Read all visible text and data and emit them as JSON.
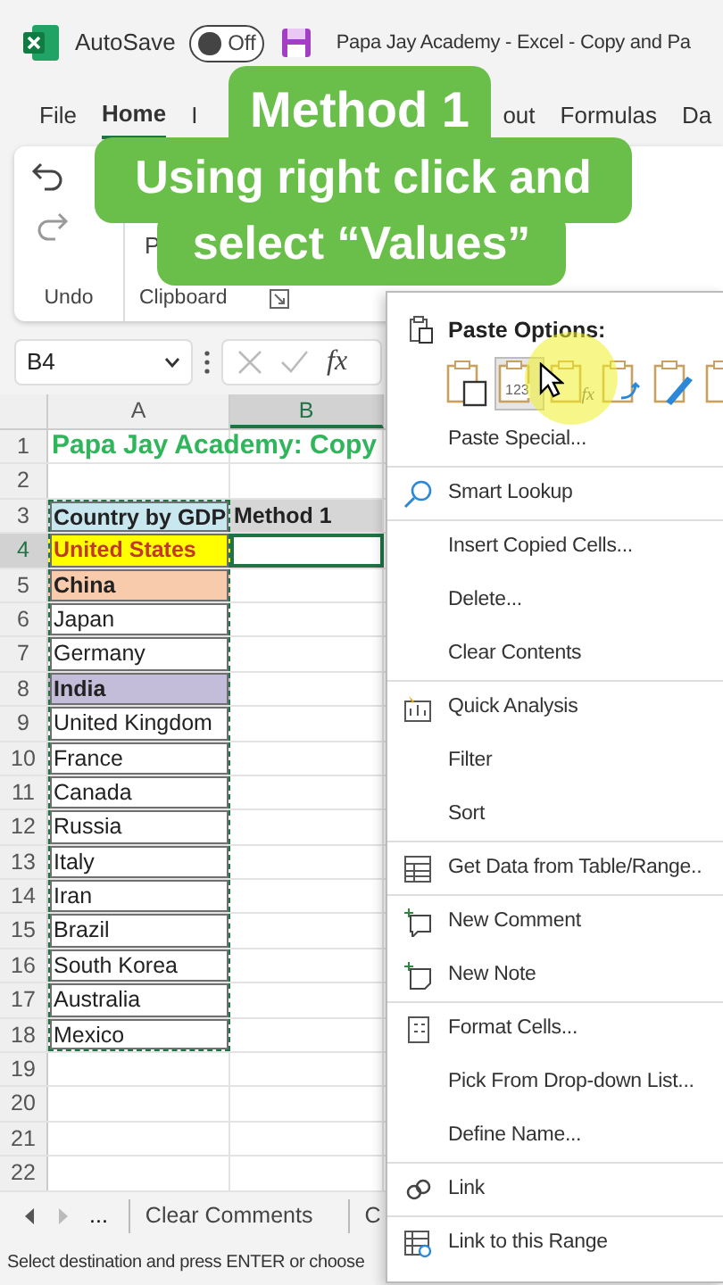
{
  "title_bar": {
    "autosave_label": "AutoSave",
    "autosave_on": false,
    "toggle_text": "Off",
    "title": "Papa Jay Academy - Excel - Copy and Pa"
  },
  "ribbon_tabs": [
    {
      "label": "File",
      "selected": false
    },
    {
      "label": "Home",
      "selected": true
    },
    {
      "label": "I",
      "selected": false
    },
    {
      "label": "out",
      "selected": false
    },
    {
      "label": "Formulas",
      "selected": false
    },
    {
      "label": "Da",
      "selected": false
    }
  ],
  "ribbon_groups": [
    {
      "label": "Undo"
    },
    {
      "label": "Clipboard",
      "partial_button": "P"
    }
  ],
  "caption": [
    "Method 1",
    "Using right click and",
    "select “Values”"
  ],
  "formula_bar": {
    "name_box": "B4",
    "fx": "fx"
  },
  "columns": [
    {
      "label": "A",
      "selected": false
    },
    {
      "label": "B",
      "selected": true
    }
  ],
  "rows": [
    {
      "number": "1",
      "selected": false,
      "copied": false,
      "table": false,
      "cells": [
        {
          "text": "Papa Jay Academy: Copy",
          "kind": "title"
        }
      ]
    },
    {
      "number": "2",
      "selected": false,
      "copied": false,
      "table": false,
      "cells": []
    },
    {
      "number": "3",
      "selected": false,
      "copied": true,
      "table": true,
      "cells": [
        {
          "text": "Country by GDP",
          "kind": "bold",
          "color": "#c9e7ef"
        },
        {
          "text": "Method 1",
          "kind": "bold",
          "color": "#d6d6d6"
        }
      ]
    },
    {
      "number": "4",
      "selected": true,
      "copied": true,
      "table": true,
      "cells": [
        {
          "text": "United States",
          "kind": "alert",
          "color": "#ffff00"
        }
      ]
    },
    {
      "number": "5",
      "selected": false,
      "copied": true,
      "table": true,
      "cells": [
        {
          "text": "China",
          "kind": "bold",
          "color": "#f8cbad"
        }
      ]
    },
    {
      "number": "6",
      "selected": false,
      "copied": true,
      "table": true,
      "cells": [
        {
          "text": "Japan",
          "kind": "plain"
        }
      ]
    },
    {
      "number": "7",
      "selected": false,
      "copied": true,
      "table": true,
      "cells": [
        {
          "text": "Germany",
          "kind": "plain"
        }
      ]
    },
    {
      "number": "8",
      "selected": false,
      "copied": true,
      "table": true,
      "cells": [
        {
          "text": "India",
          "kind": "bold",
          "color": "#c4bdd9"
        }
      ]
    },
    {
      "number": "9",
      "selected": false,
      "copied": true,
      "table": true,
      "cells": [
        {
          "text": "United Kingdom",
          "kind": "plain"
        }
      ]
    },
    {
      "number": "10",
      "selected": false,
      "copied": true,
      "table": true,
      "cells": [
        {
          "text": "France",
          "kind": "plain"
        }
      ]
    },
    {
      "number": "11",
      "selected": false,
      "copied": true,
      "table": true,
      "cells": [
        {
          "text": "Canada",
          "kind": "plain"
        }
      ]
    },
    {
      "number": "12",
      "selected": false,
      "copied": true,
      "table": true,
      "cells": [
        {
          "text": "Russia",
          "kind": "plain"
        }
      ]
    },
    {
      "number": "13",
      "selected": false,
      "copied": true,
      "table": true,
      "cells": [
        {
          "text": "Italy",
          "kind": "plain"
        }
      ]
    },
    {
      "number": "14",
      "selected": false,
      "copied": true,
      "table": true,
      "cells": [
        {
          "text": "Iran",
          "kind": "plain"
        }
      ]
    },
    {
      "number": "15",
      "selected": false,
      "copied": true,
      "table": true,
      "cells": [
        {
          "text": "Brazil",
          "kind": "plain"
        }
      ]
    },
    {
      "number": "16",
      "selected": false,
      "copied": true,
      "table": true,
      "cells": [
        {
          "text": "South Korea",
          "kind": "plain"
        }
      ]
    },
    {
      "number": "17",
      "selected": false,
      "copied": true,
      "table": true,
      "cells": [
        {
          "text": "Australia",
          "kind": "plain"
        }
      ]
    },
    {
      "number": "18",
      "selected": false,
      "copied": true,
      "table": true,
      "cells": [
        {
          "text": "Mexico",
          "kind": "plain"
        }
      ]
    },
    {
      "number": "19",
      "selected": false,
      "copied": false,
      "table": false,
      "cells": []
    },
    {
      "number": "20",
      "selected": false,
      "copied": false,
      "table": false,
      "cells": []
    },
    {
      "number": "21",
      "selected": false,
      "copied": false,
      "table": false,
      "cells": []
    },
    {
      "number": "22",
      "selected": false,
      "copied": false,
      "table": false,
      "cells": []
    }
  ],
  "sheet_tabs": {
    "more": "...",
    "tabs": [
      "Clear Comments",
      "C"
    ]
  },
  "status_bar": "Select destination and press ENTER or choose",
  "context_menu": {
    "header": "Paste Options:",
    "paste_buttons": [
      {
        "kind": "paste",
        "selected": false
      },
      {
        "kind": "values",
        "badge": "123",
        "selected": true
      },
      {
        "kind": "formulas",
        "badge": "fx",
        "selected": false
      },
      {
        "kind": "transpose",
        "selected": false
      },
      {
        "kind": "formatting",
        "selected": false
      },
      {
        "kind": "link",
        "selected": false
      }
    ],
    "items": [
      {
        "label": "Paste Special...",
        "kind": "plain",
        "separator_after": true
      },
      {
        "label": "Smart Lookup",
        "kind": "lookup",
        "separator_after": true
      },
      {
        "label": "Insert Copied Cells...",
        "kind": "plain",
        "separator_after": false
      },
      {
        "label": "Delete...",
        "kind": "plain",
        "separator_after": false
      },
      {
        "label": "Clear Contents",
        "kind": "plain",
        "separator_after": true
      },
      {
        "label": "Quick Analysis",
        "kind": "analysis",
        "separator_after": false
      },
      {
        "label": "Filter",
        "kind": "plain",
        "separator_after": false
      },
      {
        "label": "Sort",
        "kind": "plain",
        "separator_after": true
      },
      {
        "label": "Get Data from Table/Range..",
        "kind": "table",
        "separator_after": true
      },
      {
        "label": "New Comment",
        "kind": "comment",
        "separator_after": false
      },
      {
        "label": "New Note",
        "kind": "note",
        "separator_after": true
      },
      {
        "label": "Format Cells...",
        "kind": "format",
        "separator_after": false
      },
      {
        "label": "Pick From Drop-down List...",
        "kind": "plain",
        "separator_after": false
      },
      {
        "label": "Define Name...",
        "kind": "plain",
        "separator_after": true
      },
      {
        "label": "Link",
        "kind": "link",
        "separator_after": true
      },
      {
        "label": "Link to this Range",
        "kind": "rangelink",
        "separator_after": false
      }
    ]
  }
}
